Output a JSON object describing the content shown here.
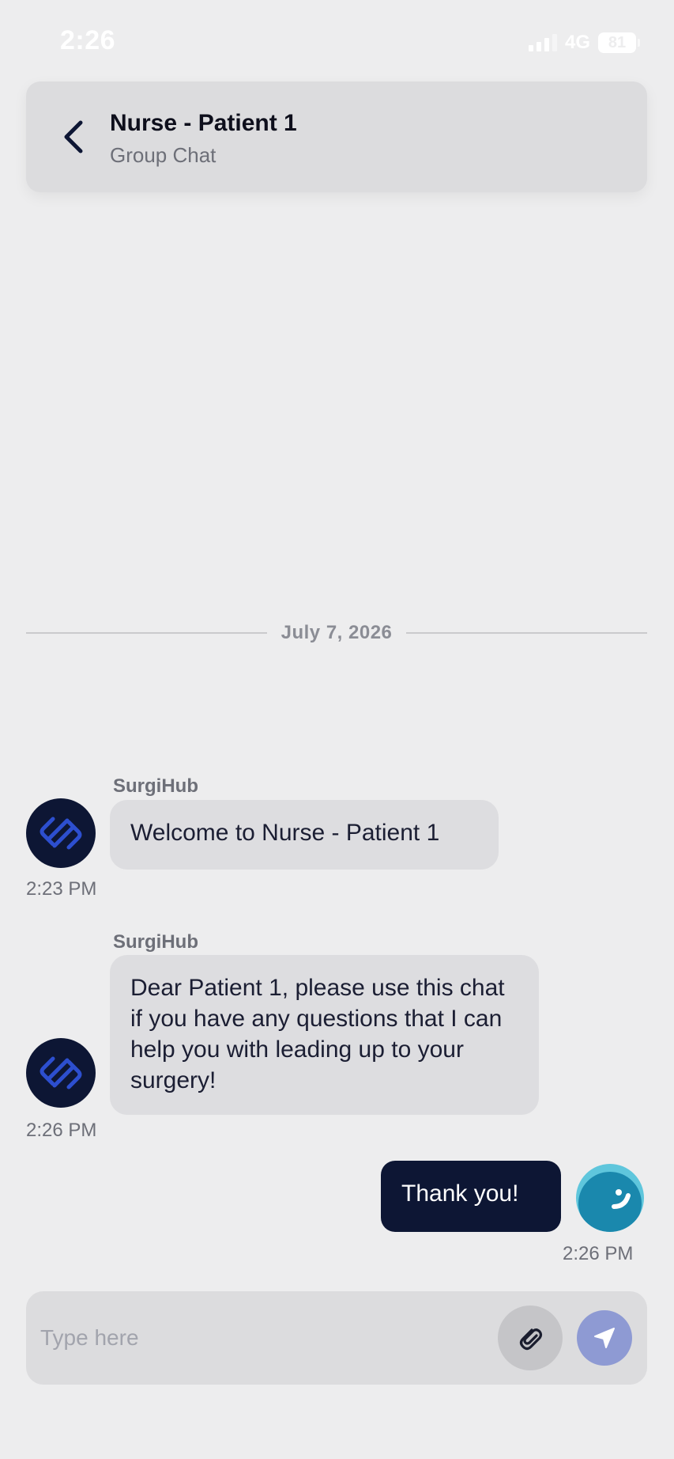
{
  "status_bar": {
    "time": "2:26",
    "network": "4G",
    "battery": "81"
  },
  "header": {
    "title": "Nurse - Patient 1",
    "subtitle": "Group Chat",
    "back_icon": "chevron-left-icon"
  },
  "chat": {
    "date_divider": "July 7, 2026",
    "messages": [
      {
        "sender": "SurgiHub",
        "text": "Welcome to Nurse - Patient 1",
        "time": "2:23 PM",
        "direction": "incoming"
      },
      {
        "sender": "SurgiHub",
        "text": "Dear Patient 1, please use this chat if you have any questions that I can help you with leading up to your surgery!",
        "time": "2:26 PM",
        "direction": "incoming"
      },
      {
        "sender": "",
        "text": "Thank you!",
        "time": "2:26 PM",
        "direction": "outgoing"
      }
    ]
  },
  "composer": {
    "placeholder": "Type here",
    "value": "",
    "attach_icon": "paperclip-icon",
    "send_icon": "send-icon"
  },
  "colors": {
    "background": "#ededee",
    "header_bg": "#dcdcde",
    "incoming_bubble": "#dddde0",
    "outgoing_bubble": "#0d1634",
    "send_button": "#8e9ad3",
    "user_avatar": "#5fc6dc"
  }
}
